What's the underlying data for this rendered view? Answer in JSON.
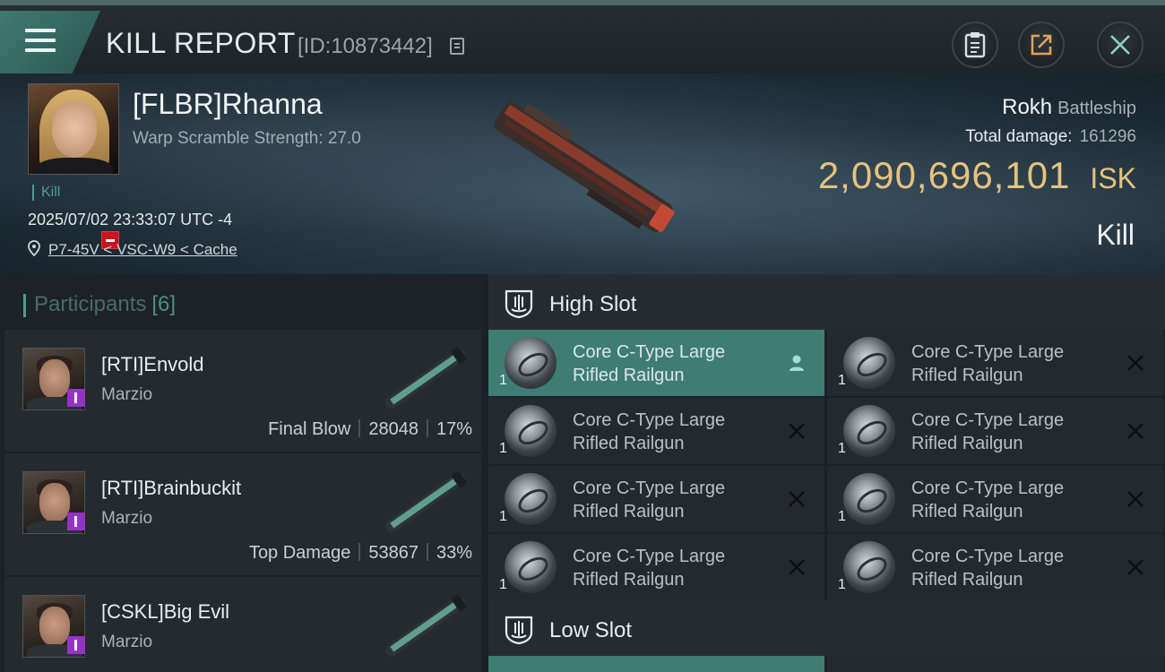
{
  "header": {
    "title": "KILL REPORT",
    "report_id": "[ID:10873442]"
  },
  "victim": {
    "name": "[FLBR]Rhanna",
    "warp_scramble": "Warp Scramble Strength: 27.0",
    "tag": "Kill",
    "datetime": "2025/07/02 23:33:07 UTC -4",
    "location": "P7-45V < VSC-W9 < Cache",
    "ship_name": "Rokh",
    "ship_class": "Battleship",
    "total_damage_label": "Total damage:",
    "total_damage": "161296",
    "isk_value": "2,090,696,101",
    "isk_unit": "ISK",
    "result": "Kill"
  },
  "participants": {
    "label": "Participants",
    "count": "[6]",
    "items": [
      {
        "name": "[RTI]Envold",
        "ship": "Marzio",
        "role": "Final Blow",
        "damage": "28048",
        "percent": "17%"
      },
      {
        "name": "[RTI]Brainbuckit",
        "ship": "Marzio",
        "role": "Top Damage",
        "damage": "53867",
        "percent": "33%"
      },
      {
        "name": "[CSKL]Big Evil",
        "ship": "Marzio",
        "role": "",
        "damage": "",
        "percent": ""
      }
    ]
  },
  "fittings": {
    "high_slot": {
      "title": "High Slot",
      "modules": [
        {
          "line1": "Core C-Type Large",
          "line2": "Rifled Railgun",
          "qty": "1",
          "status": "person-icon"
        },
        {
          "line1": "Core C-Type Large",
          "line2": "Rifled Railgun",
          "qty": "1",
          "status": "x-icon"
        },
        {
          "line1": "Core C-Type Large",
          "line2": "Rifled Railgun",
          "qty": "1",
          "status": "x-icon"
        },
        {
          "line1": "Core C-Type Large",
          "line2": "Rifled Railgun",
          "qty": "1",
          "status": "x-icon"
        },
        {
          "line1": "Core C-Type Large",
          "line2": "Rifled Railgun",
          "qty": "1",
          "status": "x-icon"
        },
        {
          "line1": "Core C-Type Large",
          "line2": "Rifled Railgun",
          "qty": "1",
          "status": "x-icon"
        },
        {
          "line1": "Core C-Type Large",
          "line2": "Rifled Railgun",
          "qty": "1",
          "status": "x-icon"
        },
        {
          "line1": "Core C-Type Large",
          "line2": "Rifled Railgun",
          "qty": "1",
          "status": "x-icon"
        }
      ]
    },
    "low_slot": {
      "title": "Low Slot"
    }
  },
  "colors": {
    "accent": "#3f7c74",
    "isk": "#e6c27e",
    "corp_badge": "#c8141c",
    "alliance_badge": "#9334c4"
  }
}
